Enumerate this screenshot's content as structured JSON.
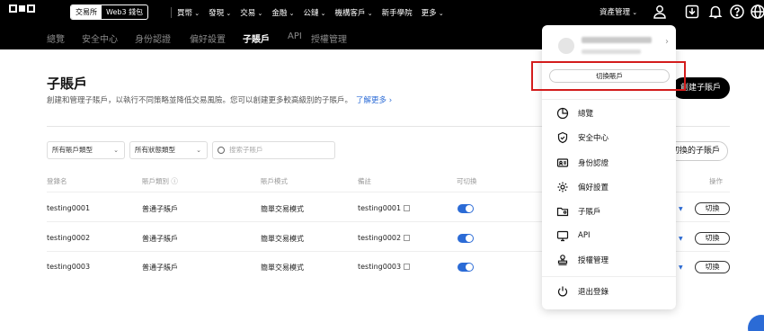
{
  "topbar": {
    "mode_exchange": "交易所",
    "mode_wallet": "Web3 錢包",
    "nav": [
      "買幣",
      "發現",
      "交易",
      "金融",
      "公鏈",
      "機構客戶",
      "新手學院",
      "更多"
    ],
    "asset_management": "資產管理"
  },
  "subnav": {
    "tabs": [
      "總覽",
      "安全中心",
      "身份認證",
      "偏好設置",
      "子賬戶",
      "API",
      "授權管理"
    ],
    "active": "子賬戶"
  },
  "page": {
    "title": "子賬戶",
    "description": "創建和管理子賬戶，以執行不同策略並降低交易風險。您可以創建更多較高級別的子賬戶。",
    "learn_more": "了解更多 ›",
    "create_label": "創建子賬戶",
    "switch_label": "切換的子賬戶"
  },
  "filters": {
    "account_type": "所有賬戶類型",
    "status_type": "所有狀態類型",
    "search_placeholder": "搜索子賬戶"
  },
  "table": {
    "headers": [
      "登錄名",
      "賬戶類別 ⓘ",
      "賬戶模式",
      "備註",
      "可切換",
      "操作"
    ],
    "rows": [
      {
        "login": "testing0001",
        "category": "普通子賬戶",
        "mode": "簡單交易模式",
        "note": "testing0001",
        "switch": "切換"
      },
      {
        "login": "testing0002",
        "category": "普通子賬戶",
        "mode": "簡單交易模式",
        "note": "testing0002",
        "switch": "切換"
      },
      {
        "login": "testing0003",
        "category": "普通子賬戶",
        "mode": "簡單交易模式",
        "note": "testing0003",
        "switch": "切換"
      }
    ]
  },
  "panel": {
    "switch_account": "切換賬戶",
    "menu": [
      "總覽",
      "安全中心",
      "身份認證",
      "偏好設置",
      "子賬戶",
      "API",
      "授權管理",
      "退出登錄"
    ]
  },
  "colors": {
    "accent_blue": "#2b6bd6",
    "highlight_red": "#d31c1c",
    "header_black": "#000000"
  }
}
